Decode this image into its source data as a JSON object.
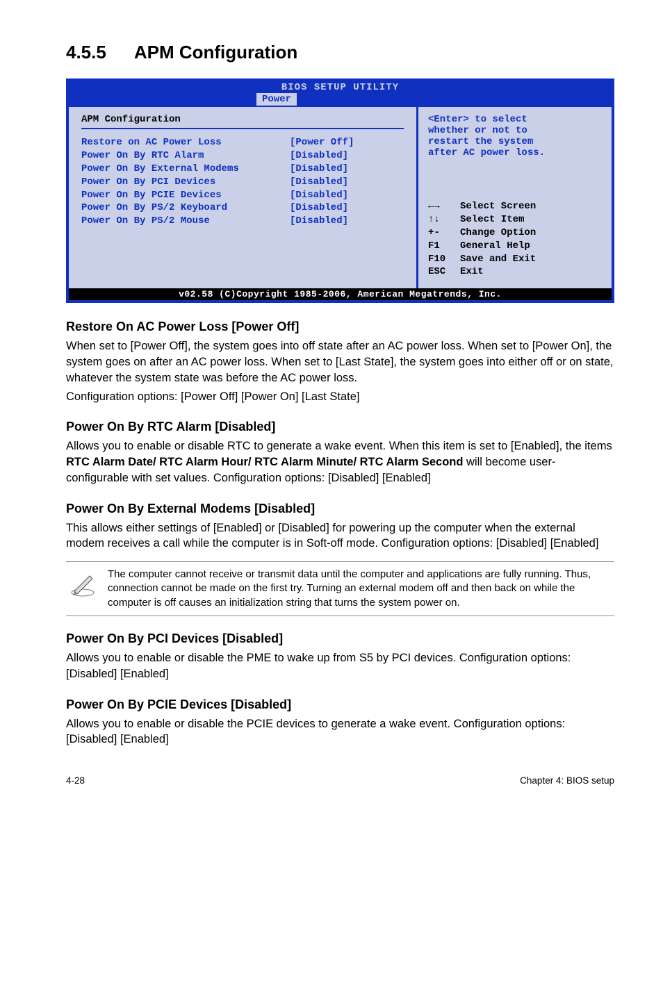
{
  "section": {
    "number": "4.5.5",
    "title": "APM Configuration"
  },
  "bios": {
    "title_bar": "BIOS SETUP UTILITY",
    "tab": "Power",
    "heading": "APM Configuration",
    "rows": [
      {
        "label": "Restore on AC Power Loss",
        "value": "[Power Off]"
      },
      {
        "label": "Power On By RTC Alarm",
        "value": "[Disabled]"
      },
      {
        "label": "Power On By External Modems",
        "value": "[Disabled]"
      },
      {
        "label": "Power On By PCI Devices",
        "value": "[Disabled]"
      },
      {
        "label": "Power On By PCIE Devices",
        "value": "[Disabled]"
      },
      {
        "label": "Power On By PS/2 Keyboard",
        "value": "[Disabled]"
      },
      {
        "label": "Power On By PS/2 Mouse",
        "value": "[Disabled]"
      }
    ],
    "help_top_l1": "<Enter> to select",
    "help_top_l2": "whether or not to",
    "help_top_l3": "restart the system",
    "help_top_l4": "after AC power loss.",
    "keys": [
      {
        "icon": "←→",
        "text": "Select Screen"
      },
      {
        "icon": "↑↓",
        "text": "Select Item"
      },
      {
        "icon": "+-",
        "text": "Change Option"
      },
      {
        "icon": "F1",
        "text": "General Help"
      },
      {
        "icon": "F10",
        "text": "Save and Exit"
      },
      {
        "icon": "ESC",
        "text": "Exit"
      }
    ],
    "footer": "v02.58 (C)Copyright 1985-2006, American Megatrends, Inc."
  },
  "restore": {
    "heading": "Restore On AC Power Loss [Power Off]",
    "p1": "When set to [Power Off], the system goes into off state after an AC power loss. When set to [Power On], the system goes on after an AC power loss. When set to [Last State], the system goes into either off or on state, whatever the system state was before the AC power loss.",
    "p2": "Configuration options: [Power Off] [Power On] [Last State]"
  },
  "rtc": {
    "heading": "Power On By RTC Alarm [Disabled]",
    "p1a": "Allows you to enable or disable RTC to generate a wake event. When this item is set to [Enabled], the items ",
    "p1b": "RTC Alarm Date/ RTC Alarm Hour/ RTC Alarm Minute/ RTC Alarm Second",
    "p1c": " will become user-configurable with set values. Configuration options: [Disabled] [Enabled]"
  },
  "ext": {
    "heading": "Power On By External Modems [Disabled]",
    "p1": "This allows either settings of [Enabled] or [Disabled] for powering up the computer when the external modem receives a call while the computer is in Soft-off mode. Configuration options: [Disabled] [Enabled]"
  },
  "note": {
    "text": "The computer cannot receive or transmit data until the computer and applications are fully running. Thus, connection cannot be made on the first try. Turning an external modem off and then back on while the computer is off causes an initialization string that turns the system power on."
  },
  "pci": {
    "heading": "Power On By PCI Devices [Disabled]",
    "p1": "Allows you to enable or disable the PME to wake up from S5 by PCI devices. Configuration options: [Disabled] [Enabled]"
  },
  "pcie": {
    "heading": "Power On By PCIE Devices [Disabled]",
    "p1": "Allows you to enable or disable the PCIE devices to generate a wake event. Configuration options: [Disabled] [Enabled]"
  },
  "footer": {
    "left": "4-28",
    "right": "Chapter 4: BIOS setup"
  }
}
